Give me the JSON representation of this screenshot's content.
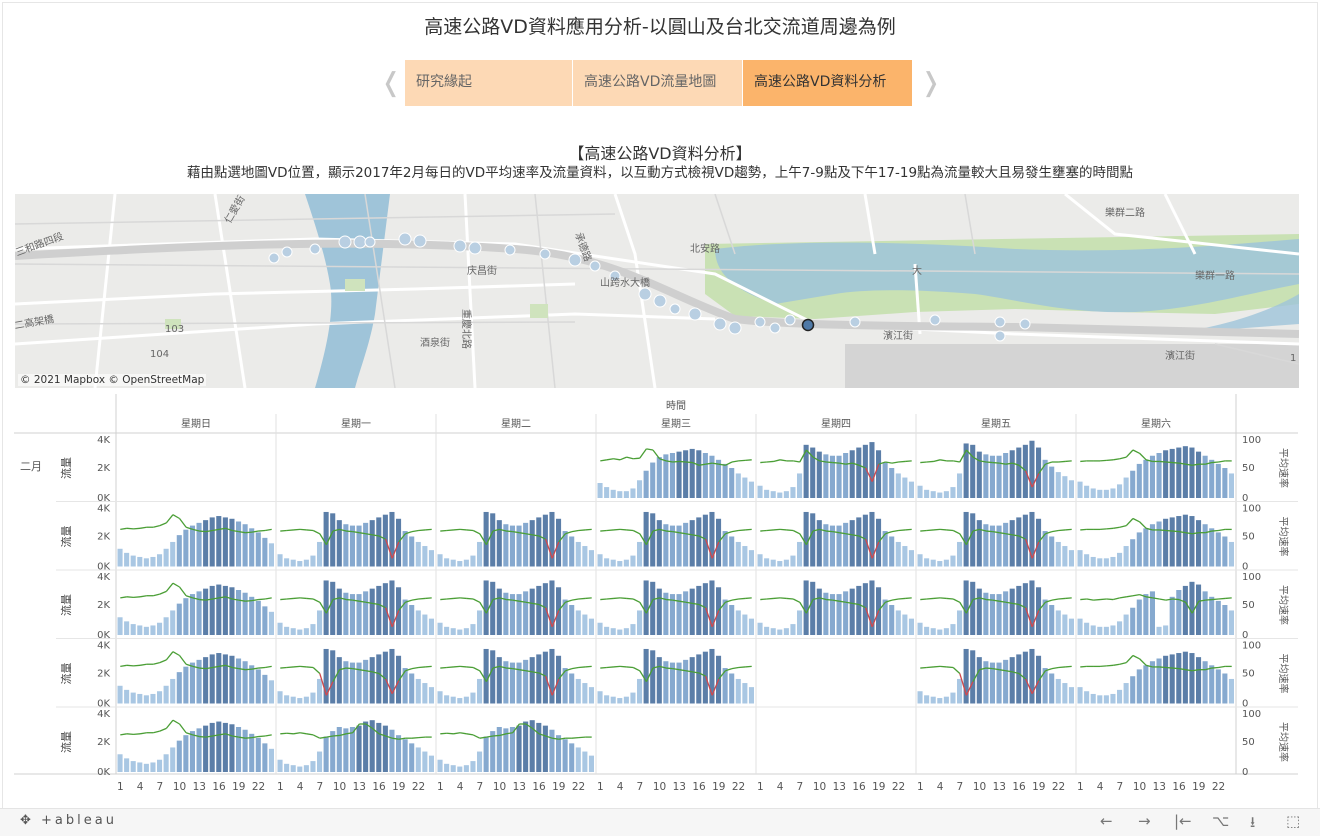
{
  "header": {
    "title": "高速公路VD資料應用分析-以圓山及台北交流道周邊為例"
  },
  "nav": {
    "prev_icon": "chevron-left-icon",
    "next_icon": "chevron-right-icon",
    "tabs": [
      {
        "label": "研究緣起",
        "color": "#fdd9b5",
        "active": false
      },
      {
        "label": "高速公路VD流量地圖",
        "color": "#fdd9b5",
        "active": false
      },
      {
        "label": "高速公路VD資料分析",
        "color": "#fbb46b",
        "active": true
      }
    ]
  },
  "section": {
    "heading": "【高速公路VD資料分析】",
    "description": "藉由點選地圖VD位置，顯示2017年2月每日的VD平均速率及流量資料，以互動方式檢視VD趨勢，上午7-9點及下午17-19點為流量較大且易發生壅塞的時間點"
  },
  "map": {
    "attribution": "© 2021 Mapbox © OpenStreetMap",
    "labels": [
      "樂群二路",
      "三和路四段",
      "仁愛街",
      "承德路",
      "北安路",
      "庆昌街",
      "山跨水大橋",
      "大",
      "二高架橋",
      "重慶北路",
      "酒泉街",
      "103",
      "104",
      "1",
      "濱江街",
      "樂群一路",
      "濱江街"
    ]
  },
  "chart_data": {
    "type": "bar+line",
    "header_label": "時間",
    "month_label": "二月",
    "days": [
      "星期日",
      "星期一",
      "星期二",
      "星期三",
      "星期四",
      "星期五",
      "星期六"
    ],
    "left_axis": {
      "label": "流量",
      "ticks": [
        "4K",
        "2K",
        "0K"
      ],
      "range": [
        0,
        4400
      ]
    },
    "right_axis": {
      "label": "平均速率",
      "ticks": [
        "100",
        "50",
        "0"
      ],
      "range": [
        0,
        110
      ]
    },
    "x_ticks": [
      "1",
      "4",
      "7",
      "10",
      "13",
      "16",
      "19",
      "22"
    ],
    "grid": [
      [
        null,
        null,
        null,
        "wed",
        "thu",
        "fri",
        "sat"
      ],
      [
        "sun",
        "weekday",
        "weekday",
        "weekday",
        "weekday",
        "weekday",
        "sat"
      ],
      [
        "sun",
        "weekday",
        "weekday",
        "weekday",
        "weekday",
        "weekday",
        "sat2"
      ],
      [
        "sun",
        "weekday2",
        "weekday",
        "weekday",
        null,
        "weekday2",
        "sat"
      ],
      [
        "sun",
        "weekday3",
        "weekday3",
        null,
        null,
        null,
        null
      ]
    ],
    "profiles": {
      "weekday": {
        "flow": [
          900,
          600,
          500,
          400,
          500,
          800,
          1800,
          4000,
          3900,
          3400,
          3100,
          3000,
          3000,
          3200,
          3400,
          3600,
          3800,
          4000,
          3500,
          2600,
          2200,
          1800,
          1500,
          1200
        ],
        "speed": [
          65,
          66,
          67,
          68,
          67,
          66,
          60,
          40,
          65,
          68,
          65,
          64,
          62,
          60,
          58,
          56,
          50,
          15,
          45,
          60,
          64,
          66,
          67,
          68
        ]
      },
      "weekday2": {
        "flow": [
          900,
          600,
          500,
          400,
          500,
          800,
          1800,
          4000,
          3900,
          3400,
          3100,
          3000,
          3000,
          3200,
          3400,
          3600,
          3800,
          4000,
          3500,
          2600,
          2200,
          1800,
          1500,
          1200
        ],
        "speed": [
          65,
          66,
          67,
          68,
          67,
          66,
          55,
          15,
          40,
          62,
          65,
          64,
          62,
          60,
          58,
          55,
          45,
          18,
          42,
          60,
          64,
          66,
          67,
          68
        ]
      },
      "weekday3": {
        "flow": [
          900,
          600,
          500,
          400,
          500,
          800,
          1500,
          2600,
          3000,
          3300,
          3200,
          3300,
          3400,
          3700,
          3800,
          3600,
          3400,
          3100,
          2700,
          2400,
          2100,
          1800,
          1500,
          1200
        ],
        "speed": [
          70,
          71,
          70,
          72,
          70,
          68,
          62,
          64,
          66,
          67,
          70,
          72,
          88,
          88,
          80,
          70,
          66,
          62,
          60,
          62,
          62,
          63,
          64,
          64
        ]
      },
      "wed": {
        "flow": [
          1100,
          800,
          600,
          500,
          500,
          700,
          1300,
          2000,
          2600,
          3000,
          3200,
          3300,
          3400,
          3500,
          3600,
          3500,
          3300,
          3100,
          2800,
          2500,
          2200,
          1800,
          1500,
          1200
        ],
        "speed": [
          68,
          70,
          72,
          70,
          75,
          72,
          73,
          90,
          88,
          72,
          68,
          66,
          67,
          66,
          65,
          60,
          62,
          64,
          62,
          60,
          66,
          68,
          69,
          70
        ]
      },
      "thu": {
        "flow": [
          900,
          600,
          500,
          400,
          500,
          800,
          1800,
          3900,
          3700,
          3400,
          3200,
          3100,
          3100,
          3300,
          3500,
          3700,
          3900,
          4100,
          3500,
          2600,
          2200,
          1800,
          1500,
          1200
        ],
        "speed": [
          65,
          66,
          67,
          70,
          68,
          68,
          66,
          88,
          75,
          68,
          66,
          65,
          64,
          62,
          64,
          60,
          55,
          30,
          62,
          66,
          64,
          66,
          67,
          68
        ]
      },
      "fri": {
        "flow": [
          900,
          600,
          500,
          400,
          500,
          800,
          1800,
          4000,
          3900,
          3400,
          3200,
          3100,
          3100,
          3300,
          3500,
          3700,
          3900,
          4200,
          3700,
          2800,
          2300,
          1900,
          1600,
          1300
        ],
        "speed": [
          65,
          66,
          67,
          70,
          68,
          68,
          66,
          88,
          75,
          68,
          66,
          65,
          64,
          62,
          64,
          60,
          50,
          20,
          45,
          62,
          66,
          66,
          67,
          68
        ]
      },
      "sat": {
        "flow": [
          1200,
          900,
          700,
          600,
          600,
          700,
          1000,
          1500,
          2000,
          2500,
          2800,
          3100,
          3300,
          3500,
          3600,
          3700,
          3800,
          3700,
          3400,
          3100,
          2800,
          2500,
          2200,
          1800
        ],
        "speed": [
          67,
          68,
          68,
          68,
          69,
          70,
          72,
          75,
          88,
          82,
          70,
          67,
          67,
          66,
          65,
          64,
          62,
          60,
          62,
          62,
          65,
          66,
          68,
          68
        ]
      },
      "sat2": {
        "flow": [
          1200,
          900,
          700,
          600,
          600,
          700,
          1000,
          1500,
          2000,
          2600,
          3000,
          3200,
          600,
          700,
          2800,
          3300,
          3600,
          3900,
          3700,
          3200,
          2800,
          2500,
          2200,
          1800
        ],
        "speed": [
          65,
          66,
          64,
          65,
          66,
          65,
          68,
          70,
          72,
          74,
          70,
          68,
          66,
          64,
          66,
          65,
          60,
          40,
          62,
          64,
          65,
          66,
          67,
          68
        ]
      },
      "sun": {
        "flow": [
          1300,
          1000,
          800,
          700,
          600,
          700,
          900,
          1300,
          1800,
          2300,
          2700,
          3000,
          3200,
          3400,
          3600,
          3700,
          3600,
          3500,
          3300,
          3100,
          2800,
          2500,
          2100,
          1700
        ],
        "speed": [
          68,
          70,
          69,
          70,
          72,
          72,
          75,
          80,
          95,
          88,
          72,
          68,
          65,
          64,
          66,
          68,
          70,
          66,
          64,
          62,
          63,
          65,
          66,
          68
        ]
      }
    },
    "colors": {
      "bar_base": "#a9c7e3",
      "bar_mid": "#86a9cf",
      "bar_dark": "#5b7ea8",
      "line": "#4a9e35",
      "line_low": "#d0484c"
    }
  },
  "footer": {
    "logo": "+ableau",
    "icons": [
      "undo-icon",
      "redo-icon",
      "revert-icon",
      "share-icon",
      "download-icon",
      "fullscreen-icon"
    ]
  }
}
